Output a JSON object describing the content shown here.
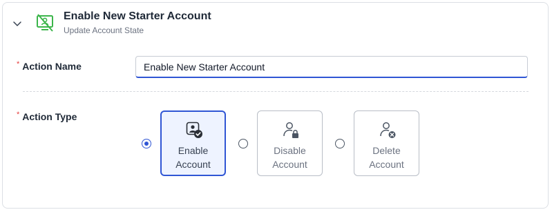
{
  "header": {
    "title": "Enable New Starter Account",
    "subtitle": "Update Account State"
  },
  "fields": {
    "action_name": {
      "label": "Action Name",
      "required_marker": "*",
      "value": "Enable New Starter Account"
    },
    "action_type": {
      "label": "Action Type",
      "required_marker": "*",
      "selected": "Enable Account",
      "options": [
        {
          "label": "Enable\nAccount",
          "icon": "user-check-icon",
          "selected": true
        },
        {
          "label": "Disable\nAccount",
          "icon": "user-lock-icon",
          "selected": false
        },
        {
          "label": "Delete\nAccount",
          "icon": "user-delete-icon",
          "selected": false
        }
      ]
    }
  },
  "colors": {
    "accent": "#2f55d4",
    "header_icon": "#3bb54a",
    "required": "#e53e3e"
  }
}
